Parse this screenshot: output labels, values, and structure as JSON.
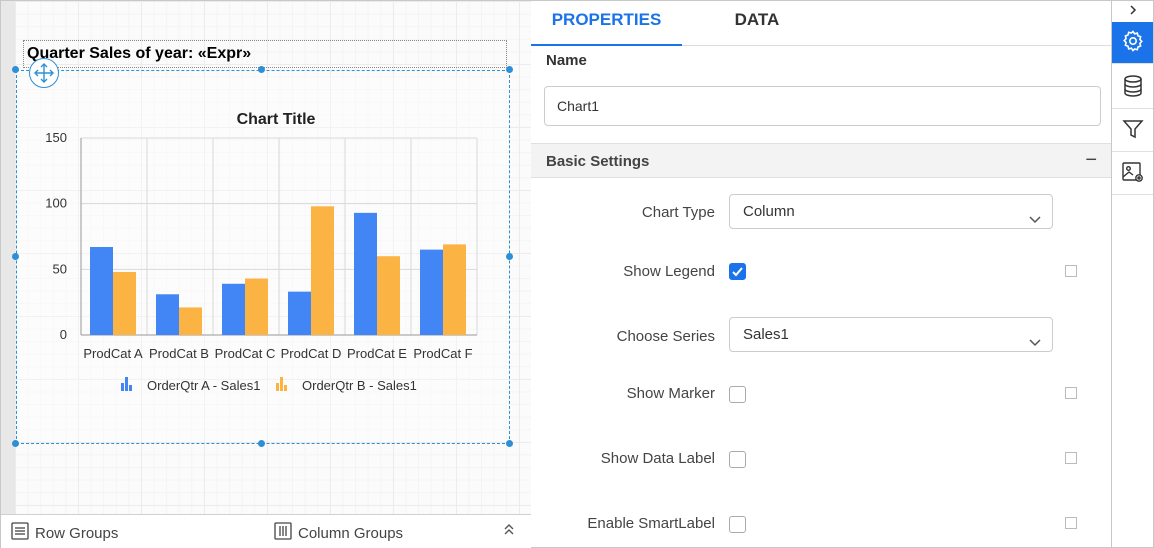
{
  "designer": {
    "report_title": "Quarter Sales of year: «Expr»",
    "bottom_bar": {
      "row_groups": "Row Groups",
      "column_groups": "Column Groups"
    }
  },
  "chart_data": {
    "type": "bar",
    "title": "Chart Title",
    "categories": [
      "ProdCat A",
      "ProdCat B",
      "ProdCat C",
      "ProdCat D",
      "ProdCat E",
      "ProdCat F"
    ],
    "series": [
      {
        "name": "OrderQtr A - Sales1",
        "color": "#4285f4",
        "values": [
          67,
          31,
          39,
          33,
          93,
          65
        ]
      },
      {
        "name": "OrderQtr B - Sales1",
        "color": "#fbb343",
        "values": [
          48,
          21,
          43,
          98,
          60,
          69
        ]
      }
    ],
    "ylim": [
      0,
      150
    ],
    "yticks": [
      "0",
      "50",
      "100",
      "150"
    ],
    "grid": true,
    "legend": "bottom"
  },
  "panel": {
    "tabs": [
      {
        "label": "PROPERTIES",
        "active": true
      },
      {
        "label": "DATA",
        "active": false
      }
    ],
    "name_label": "Name",
    "name_value": "Chart1",
    "section_title": "Basic Settings",
    "collapse_symbol": "−",
    "chart_type_label": "Chart Type",
    "chart_type_value": "Column",
    "show_legend_label": "Show Legend",
    "choose_series_label": "Choose Series",
    "choose_series_value": "Sales1",
    "show_marker_label": "Show Marker",
    "show_data_label_label": "Show Data Label",
    "enable_smartlabel_label": "Enable SmartLabel"
  },
  "toolbar": {
    "items": [
      "chevron-right-icon",
      "gear-icon",
      "database-icon",
      "filter-icon",
      "image-settings-icon"
    ],
    "accent": "#1a73e8"
  }
}
